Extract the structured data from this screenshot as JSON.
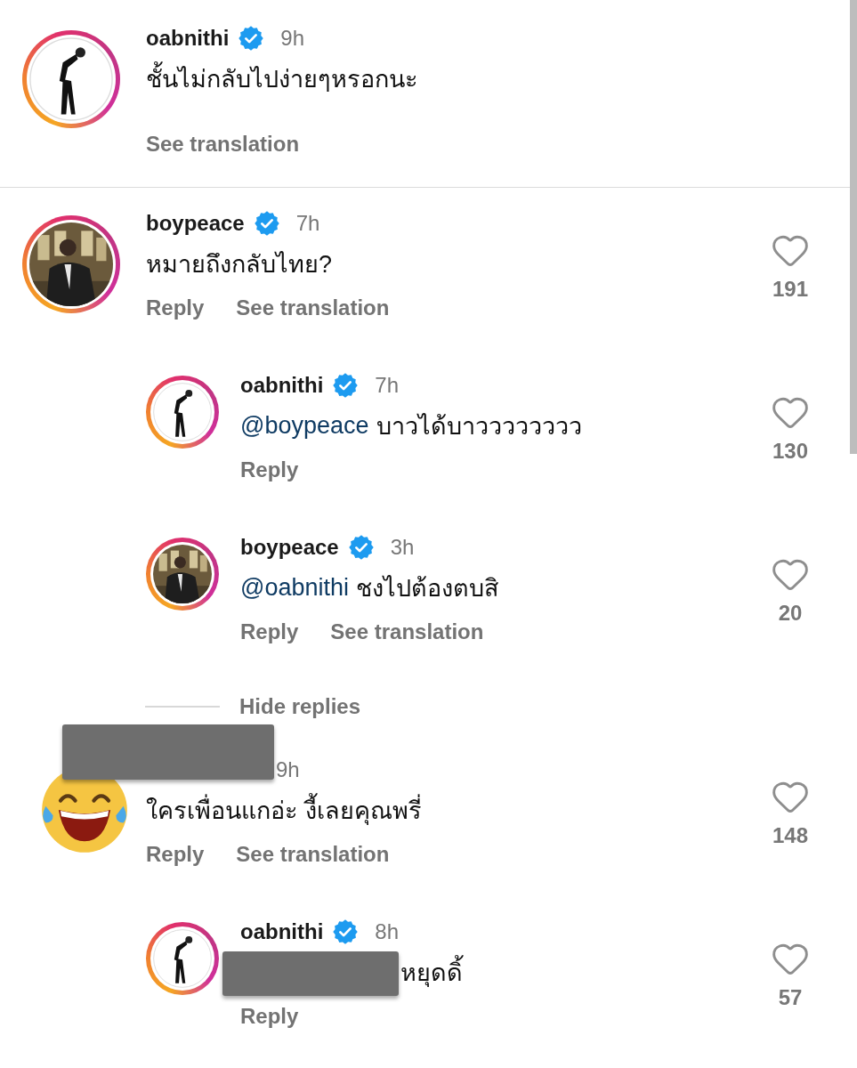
{
  "comments": [
    {
      "kind": "comment",
      "avatar": {
        "kind": "figure"
      },
      "username": "oabnithi",
      "verified": true,
      "time": "9h",
      "text": "ชั้นไม่กลับไปง่ายๆหรอกนะ",
      "actions": [
        "See translation"
      ],
      "divider": true
    },
    {
      "kind": "comment",
      "username": "boypeace",
      "verified": true,
      "time": "7h",
      "text": "หมายถึงกลับไทย?",
      "actions": [
        "Reply",
        "See translation"
      ],
      "likes": "191"
    },
    {
      "kind": "reply",
      "avatar": {
        "kind": "figure"
      },
      "username": "oabnithi",
      "verified": true,
      "time": "7h",
      "mention": "@boypeace",
      "text": "บาวได้บาวววววววว",
      "actions": [
        "Reply"
      ],
      "likes": "130"
    },
    {
      "kind": "reply",
      "username": "boypeace",
      "verified": true,
      "time": "3h",
      "mention": "@oabnithi",
      "text": "ชงไปต้องตบสิ",
      "actions": [
        "Reply",
        "See translation"
      ],
      "likes": "20"
    },
    {
      "kind": "hide-replies",
      "label": "Hide replies"
    },
    {
      "kind": "comment",
      "avatar": {
        "kind": "emoji"
      },
      "redacted": true,
      "time": "9h",
      "text": "ใครเพื่อนแกอ่ะ งี้เลยคุณพรี่",
      "actions": [
        "Reply",
        "See translation"
      ],
      "likes": "148"
    },
    {
      "kind": "reply",
      "avatar": {
        "kind": "figure"
      },
      "redacted": true,
      "username": "oabnithi",
      "verified": true,
      "time": "8h",
      "text": "หยุดดิ้",
      "actions": [
        "Reply"
      ],
      "likes": "57"
    }
  ]
}
